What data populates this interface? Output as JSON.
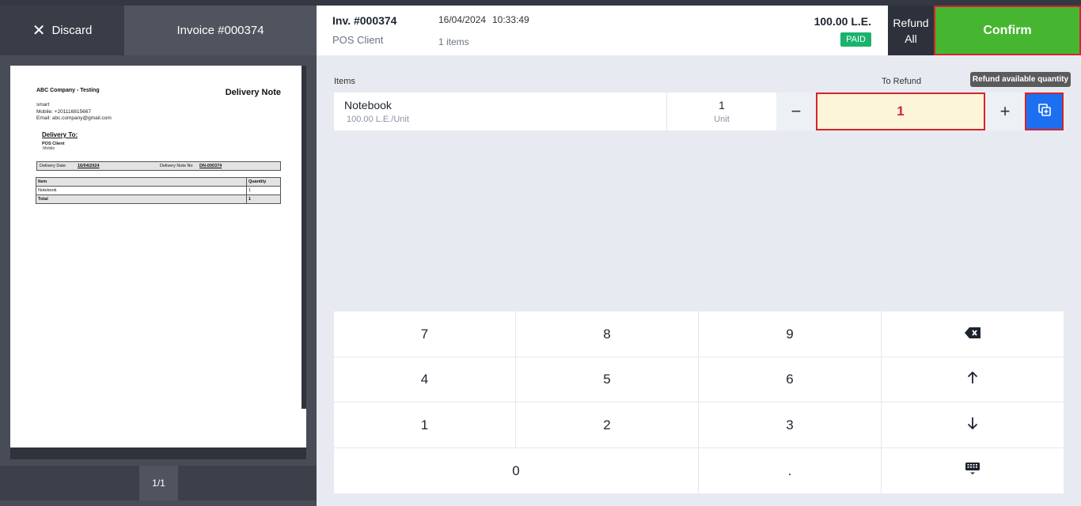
{
  "left_panel": {
    "discard_label": "Discard",
    "invoice_title": "Invoice #000374",
    "pager": "1/1"
  },
  "document": {
    "company": "ABC Company - Testing",
    "title": "Delivery Note",
    "info_lines": [
      "smart",
      "Mobile: +201116815667",
      "Email: abc.company@gmail.com"
    ],
    "delivery_to_heading": "Delivery To:",
    "client_name": "POS Client",
    "client_mobile": ":Mobile",
    "delivery_date_label": "Delivery Date",
    "delivery_date": "16/04/2024",
    "delivery_no_label": "Delivery Note No",
    "delivery_no": "DN-000374",
    "table_headers": [
      "Item",
      "Quantity"
    ],
    "rows": [
      {
        "item": "Notebook",
        "qty": "1"
      }
    ],
    "total_label": "Total",
    "total_qty": "1"
  },
  "header": {
    "invoice_no": "Inv. #000374",
    "client": "POS Client",
    "date": "16/04/2024",
    "time": "10:33:49",
    "items_count": "1 items",
    "total": "100.00 L.E.",
    "status": "PAID",
    "refund_all_line1": "Refund",
    "refund_all_line2": "All",
    "confirm_label": "Confirm"
  },
  "items_section": {
    "items_label": "Items",
    "to_refund_label": "To Refund",
    "tooltip": "Refund available quantity",
    "item": {
      "name": "Notebook",
      "price": "100.00 L.E./Unit",
      "qty": "1",
      "unit": "Unit",
      "refund_qty": "1"
    },
    "minus": "−",
    "plus": "+"
  },
  "keypad": {
    "keys": [
      "7",
      "8",
      "9",
      "4",
      "5",
      "6",
      "1",
      "2",
      "3",
      "0",
      "."
    ],
    "icons": [
      "backspace-icon",
      "arrow-up-icon",
      "arrow-down-icon",
      "keyboard-icon"
    ]
  },
  "colors": {
    "confirm_green": "#46b631",
    "paid_green": "#19b36b",
    "refund_blue": "#1b6ff0",
    "highlight_red": "#d5232f",
    "input_yellow": "#fdf5d9"
  }
}
